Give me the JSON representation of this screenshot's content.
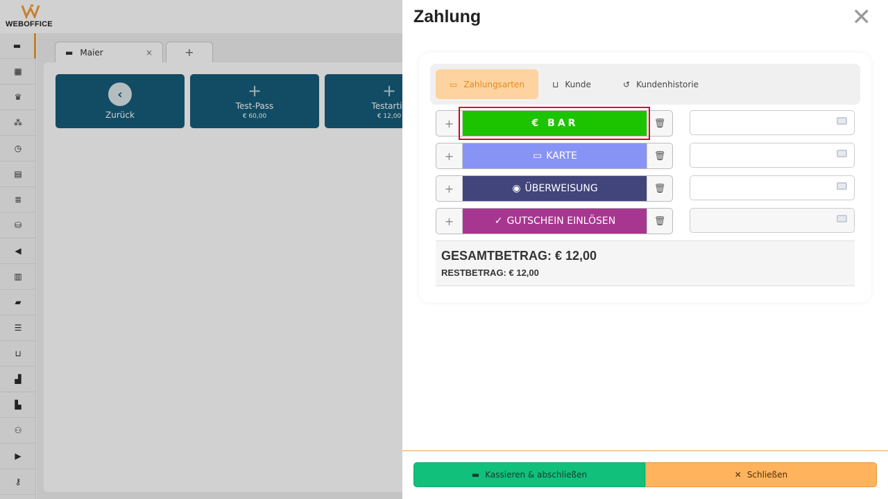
{
  "app": {
    "logo_text": "WEBOFFICE",
    "tabs": [
      {
        "label": "Maier",
        "close": "×"
      },
      {
        "label": "+"
      }
    ],
    "tiles": [
      {
        "label": "Zurück",
        "icon": "chevron-left-icon"
      },
      {
        "label": "Test-Pass",
        "price": "€ 60,00"
      },
      {
        "label": "Testartik",
        "price": "€ 12,00"
      }
    ],
    "sidebar_icons": [
      "register-icon",
      "calendar-icon",
      "crown-icon",
      "network-icon",
      "clock-icon",
      "document-icon",
      "list-icon",
      "stack-icon",
      "megaphone-icon",
      "chart-icon",
      "folder-icon",
      "database-icon",
      "cart-icon",
      "warehouse-icon",
      "factory-chart-icon",
      "users-icon",
      "truck-icon",
      "key-icon"
    ]
  },
  "panel": {
    "title": "Zahlung",
    "close_label": "✕",
    "tabs": [
      {
        "label": "Zahlungsarten",
        "icon": "cash-icon",
        "active": true
      },
      {
        "label": "Kunde",
        "icon": "cart-icon",
        "active": false
      },
      {
        "label": "Kundenhistorie",
        "icon": "history-icon",
        "active": false
      }
    ],
    "methods": [
      {
        "label": "€ BAR",
        "color": "#1cc400",
        "highlighted": true
      },
      {
        "label": "KARTE",
        "color": "#8893f6",
        "icon": "credit-card-icon"
      },
      {
        "label": "ÜBERWEISUNG",
        "color": "#41457b",
        "icon": "piggy-bank-icon"
      },
      {
        "label": "GUTSCHEIN EINLÖSEN",
        "color": "#a73690",
        "icon": "check-icon"
      }
    ],
    "gesamtbetrag": "GESAMTBETRAG: € 12,00",
    "restbetrag": "RESTBETRAG: € 12,00",
    "buttons": {
      "kassieren": "Kassieren & abschließen",
      "schliessen": "Schließen"
    }
  },
  "colors": {
    "accent": "#f29d38",
    "tile": "#175d7a",
    "kassieren": "#11c07b",
    "schliessen": "#ffb35c"
  }
}
